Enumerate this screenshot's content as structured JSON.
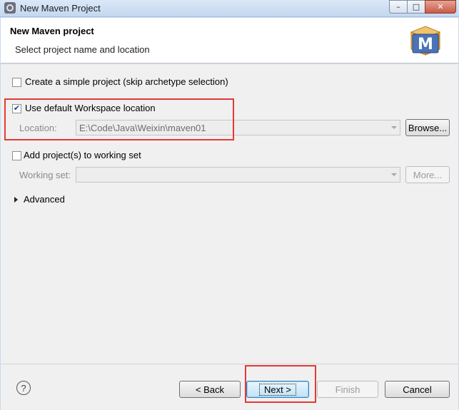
{
  "window": {
    "title": "New Maven Project",
    "controls": {
      "minimize": "–",
      "maximize": "□",
      "close": "✕"
    }
  },
  "header": {
    "title": "New Maven project",
    "subtitle": "Select project name and location",
    "logo_letter": "M"
  },
  "options": {
    "simple_project": {
      "label": "Create a simple project (skip archetype selection)",
      "checked": false
    },
    "default_workspace": {
      "label": "Use default Workspace location",
      "checked": true
    },
    "location": {
      "label": "Location:",
      "value": "E:\\Code\\Java\\Weixin\\maven01",
      "browse_label": "Browse..."
    },
    "working_set_check": {
      "label": "Add project(s) to working set",
      "checked": false
    },
    "working_set": {
      "label": "Working set:",
      "value": "",
      "more_label": "More..."
    },
    "advanced": {
      "label": "Advanced",
      "expanded": false
    }
  },
  "footer": {
    "help": "?",
    "back": "< Back",
    "next": "Next >",
    "finish": "Finish",
    "cancel": "Cancel"
  },
  "colors": {
    "highlight": "#e53935",
    "accent": "#3c7fb1"
  }
}
